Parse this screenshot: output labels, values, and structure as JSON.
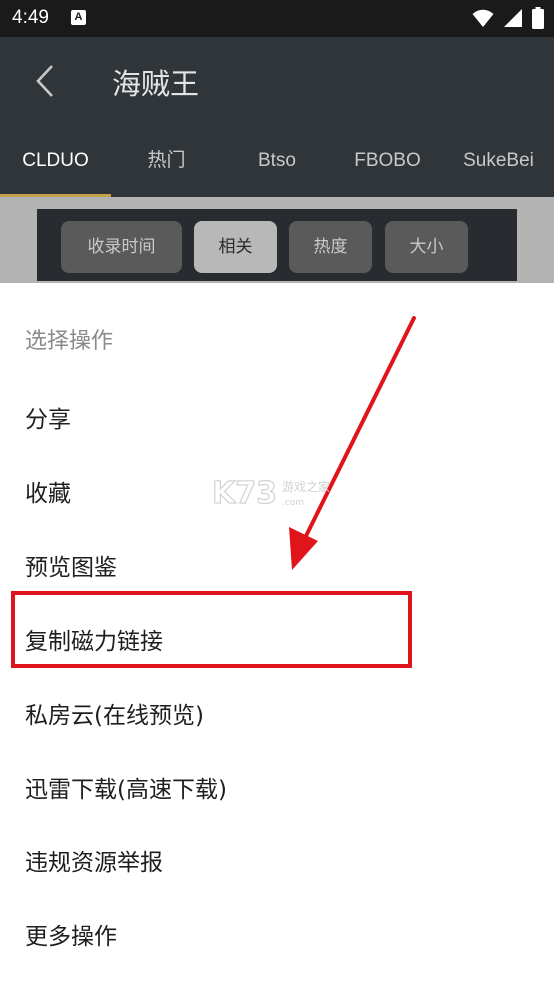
{
  "status_bar": {
    "time": "4:49",
    "app_icon_letter": "A",
    "icons": [
      "wifi-icon",
      "signal-icon",
      "battery-icon"
    ]
  },
  "toolbar": {
    "title": "海贼王",
    "back_icon": "chevron-left-icon"
  },
  "tabs": [
    {
      "label": "CLDUO",
      "active": true
    },
    {
      "label": "热门",
      "active": false
    },
    {
      "label": "Btso",
      "active": false
    },
    {
      "label": "FBOBO",
      "active": false
    },
    {
      "label": "SukeBei",
      "active": false
    }
  ],
  "sort_options": [
    {
      "label": "收录时间",
      "active": false
    },
    {
      "label": "相关",
      "active": true
    },
    {
      "label": "热度",
      "active": false
    },
    {
      "label": "大小",
      "active": false
    }
  ],
  "dialog": {
    "title": "选择操作",
    "items": [
      "分享",
      "收藏",
      "预览图鉴",
      "复制磁力链接",
      "私房云(在线预览)",
      "迅雷下载(高速下载)",
      "违规资源举报",
      "更多操作"
    ]
  },
  "watermark": {
    "text": "K73",
    "subtext": "游戏之家"
  },
  "colors": {
    "toolbar_bg": "#30353a",
    "tab_indicator": "#c3a24e",
    "annotation_red": "#e0151b"
  }
}
